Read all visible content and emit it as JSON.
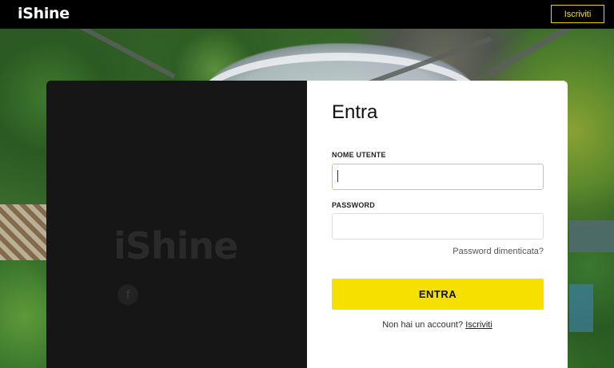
{
  "header": {
    "logo": "iShine",
    "signup_label": "Iscriviti"
  },
  "left_panel": {
    "watermark": "iShine",
    "social_icon": "facebook-icon"
  },
  "login": {
    "title": "Entra",
    "username_label": "NOME UTENTE",
    "username_value": "",
    "password_label": "PASSWORD",
    "password_value": "",
    "forgot_label": "Password dimenticata?",
    "submit_label": "ENTRA",
    "no_account_text": "Non hai un account?",
    "signup_link": "Iscriviti"
  },
  "colors": {
    "accent": "#f5e000",
    "topbar": "#000000",
    "dark_panel": "#161616"
  }
}
